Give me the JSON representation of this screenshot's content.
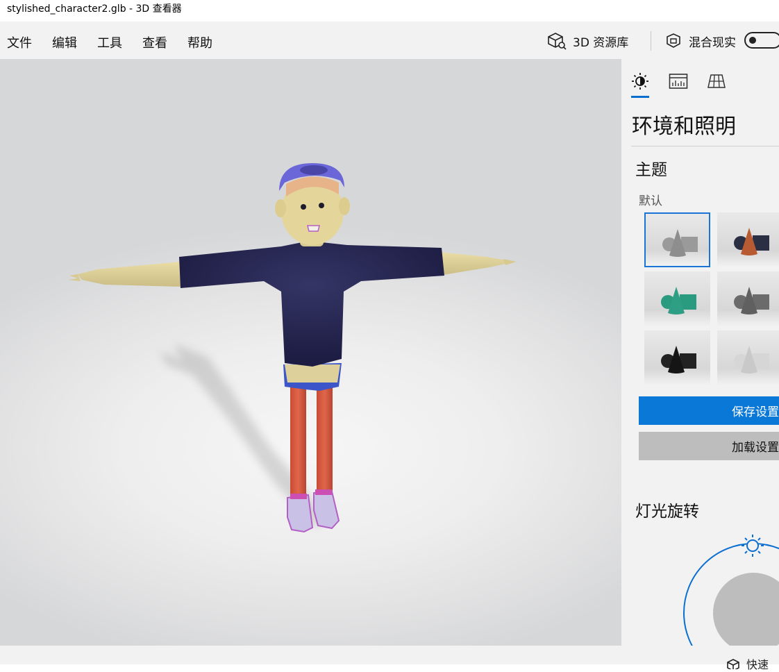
{
  "window": {
    "title": "stylished_character2.glb - 3D 查看器"
  },
  "menu": {
    "items": [
      "文件",
      "编辑",
      "工具",
      "查看",
      "帮助"
    ],
    "library_label": "3D 资源库",
    "mixed_reality_label": "混合现实",
    "mixed_reality_on": false
  },
  "panel": {
    "tabs": [
      "lighting-tab",
      "stats-tab",
      "grid-tab"
    ],
    "active_tab": "lighting-tab",
    "heading": "环境和照明",
    "theme_section": "主题",
    "theme_group_label": "默认",
    "themes": [
      {
        "name": "gray",
        "primary": "#8e8e8e",
        "secondary": "#9a9a9a",
        "selected": true
      },
      {
        "name": "orange",
        "primary": "#b85a32",
        "secondary": "#2b2f44",
        "selected": false
      },
      {
        "name": "teal",
        "primary": "#2e9e84",
        "secondary": "#2b9b7f",
        "selected": false
      },
      {
        "name": "dark-gray",
        "primary": "#606060",
        "secondary": "#6b6b6b",
        "selected": false
      },
      {
        "name": "black",
        "primary": "#151515",
        "secondary": "#222222",
        "selected": false
      },
      {
        "name": "light",
        "primary": "#c9c9c9",
        "secondary": "#d6d6d6",
        "selected": false
      }
    ],
    "save_label": "保存设置",
    "load_label": "加载设置",
    "light_rotation_title": "灯光旋转"
  },
  "statusbar": {
    "label": "快速"
  },
  "colors": {
    "accent": "#0a78d7",
    "shirt": "#27264f",
    "skin": "#e2d49a",
    "legs": "#d05a40",
    "cap": "#6b67d8"
  }
}
